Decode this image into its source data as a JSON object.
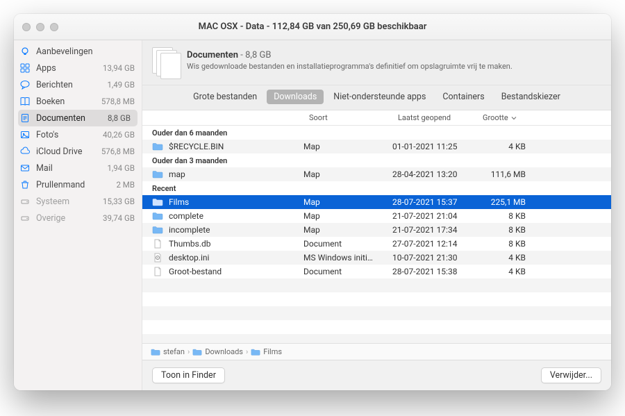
{
  "window_title": "MAC OSX - Data - 112,84 GB van 250,69 GB beschikbaar",
  "sidebar": [
    {
      "icon": "bulb",
      "label": "Aanbevelingen",
      "value": "",
      "dim": false
    },
    {
      "icon": "apps",
      "label": "Apps",
      "value": "13,94 GB",
      "dim": false
    },
    {
      "icon": "chat",
      "label": "Berichten",
      "value": "1,49 GB",
      "dim": false
    },
    {
      "icon": "book",
      "label": "Boeken",
      "value": "578,8 MB",
      "dim": false
    },
    {
      "icon": "doc",
      "label": "Documenten",
      "value": "8,8 GB",
      "dim": false,
      "selected": true
    },
    {
      "icon": "photo",
      "label": "Foto's",
      "value": "40,26 GB",
      "dim": false
    },
    {
      "icon": "cloud",
      "label": "iCloud Drive",
      "value": "576,8 MB",
      "dim": false
    },
    {
      "icon": "mail",
      "label": "Mail",
      "value": "1,94 GB",
      "dim": false
    },
    {
      "icon": "trash",
      "label": "Prullenmand",
      "value": "2 MB",
      "dim": false
    },
    {
      "icon": "disk",
      "label": "Systeem",
      "value": "15,33 GB",
      "dim": true
    },
    {
      "icon": "disk",
      "label": "Overige",
      "value": "39,74 GB",
      "dim": true
    }
  ],
  "info": {
    "title": "Documenten",
    "size": "8,8 GB",
    "desc": "Wis gedownloade bestanden en installatieprogramma's definitief om opslagruimte vrij te maken."
  },
  "tabs": [
    {
      "label": "Grote bestanden"
    },
    {
      "label": "Downloads",
      "selected": true
    },
    {
      "label": "Niet-ondersteunde apps"
    },
    {
      "label": "Containers"
    },
    {
      "label": "Bestandskiezer"
    }
  ],
  "columns": {
    "name": "",
    "kind": "Soort",
    "opened": "Laatst geopend",
    "size": "Grootte"
  },
  "groups": [
    {
      "title": "Ouder dan 6 maanden",
      "rows": [
        {
          "icon": "folder",
          "name": "$RECYCLE.BIN",
          "kind": "Map",
          "opened": "01-01-2021 11:25",
          "size": "4 KB",
          "alt": true
        }
      ]
    },
    {
      "title": "Ouder dan 3 maanden",
      "rows": [
        {
          "icon": "folder",
          "name": "map",
          "kind": "Map",
          "opened": "28-04-2021 13:20",
          "size": "111,6 MB",
          "alt": true
        }
      ]
    },
    {
      "title": "Recent",
      "rows": [
        {
          "icon": "folder",
          "name": "Films",
          "kind": "Map",
          "opened": "28-07-2021 15:37",
          "size": "225,1 MB",
          "alt": true,
          "selected": true
        },
        {
          "icon": "folder",
          "name": "complete",
          "kind": "Map",
          "opened": "21-07-2021 21:04",
          "size": "8 KB"
        },
        {
          "icon": "folder",
          "name": "incomplete",
          "kind": "Map",
          "opened": "21-07-2021 17:34",
          "size": "8 KB",
          "alt": true
        },
        {
          "icon": "file",
          "name": "Thumbs.db",
          "kind": "Document",
          "opened": "27-07-2021 12:14",
          "size": "8 KB"
        },
        {
          "icon": "fileini",
          "name": "desktop.ini",
          "kind": "MS Windows initi…",
          "opened": "10-07-2021 21:30",
          "size": "4 KB",
          "alt": true
        },
        {
          "icon": "file",
          "name": "Groot-bestand",
          "kind": "Document",
          "opened": "28-07-2021 15:38",
          "size": "4 KB"
        }
      ]
    }
  ],
  "breadcrumb": [
    "stefan",
    "Downloads",
    "Films"
  ],
  "buttons": {
    "finder": "Toon in Finder",
    "delete": "Verwijder..."
  }
}
